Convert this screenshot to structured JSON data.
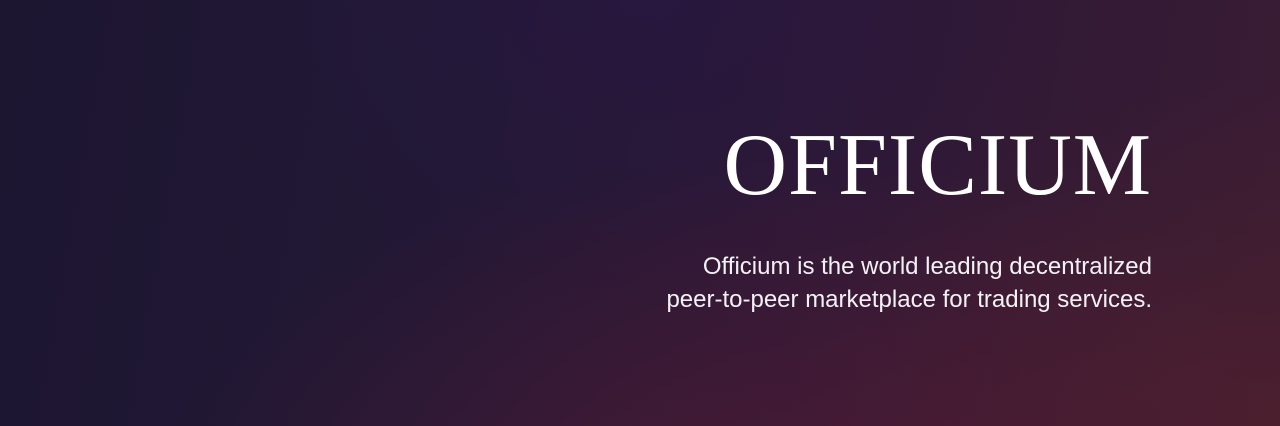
{
  "hero": {
    "brand_name": "OFFICIUM",
    "tagline_line1": "Officium is the world leading decentralized",
    "tagline_line2": "peer-to-peer marketplace for trading services."
  },
  "colors": {
    "background_dark": "#1c1631",
    "background_accent": "#3a1c34",
    "text": "#ffffff"
  }
}
